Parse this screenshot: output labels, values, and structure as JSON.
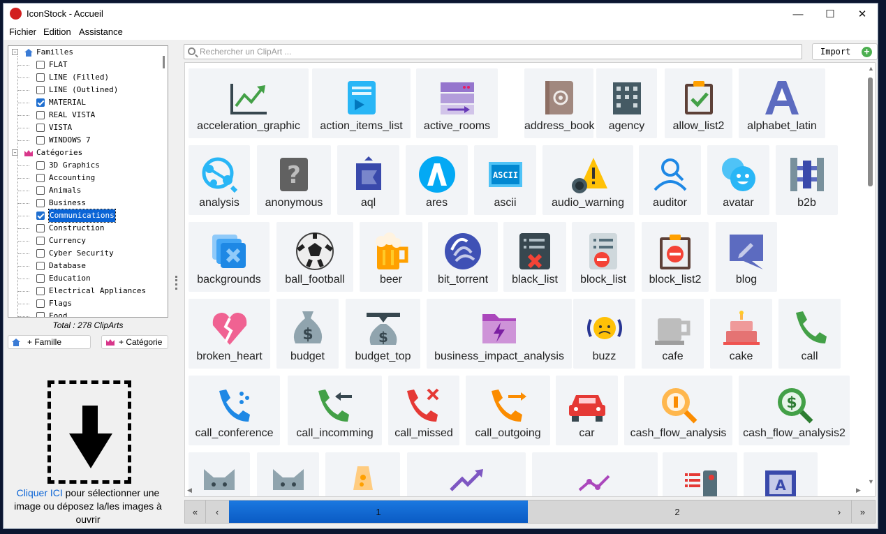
{
  "window": {
    "title": "IconStock - Accueil"
  },
  "menu": [
    "Fichier",
    "Edition",
    "Assistance"
  ],
  "tree": {
    "familles_label": "Familles",
    "familles": [
      {
        "label": "FLAT",
        "checked": false
      },
      {
        "label": "LINE (Filled)",
        "checked": false
      },
      {
        "label": "LINE (Outlined)",
        "checked": false
      },
      {
        "label": "MATERIAL",
        "checked": true
      },
      {
        "label": "REAL VISTA",
        "checked": false
      },
      {
        "label": "VISTA",
        "checked": false
      },
      {
        "label": "WINDOWS 7",
        "checked": false
      }
    ],
    "categories_label": "Catégories",
    "categories": [
      {
        "label": "3D Graphics",
        "checked": false
      },
      {
        "label": "Accounting",
        "checked": false
      },
      {
        "label": "Animals",
        "checked": false
      },
      {
        "label": "Business",
        "checked": false
      },
      {
        "label": "Communications",
        "checked": true,
        "selected": true
      },
      {
        "label": "Construction",
        "checked": false
      },
      {
        "label": "Currency",
        "checked": false
      },
      {
        "label": "Cyber Security",
        "checked": false
      },
      {
        "label": "Database",
        "checked": false
      },
      {
        "label": "Education",
        "checked": false
      },
      {
        "label": "Electrical Appliances",
        "checked": false
      },
      {
        "label": "Flags",
        "checked": false
      },
      {
        "label": "Food",
        "checked": false
      }
    ]
  },
  "total": "Total : 278 ClipArts",
  "buttons": {
    "add_family": "+ Famille",
    "add_category": "+ Catégorie",
    "import": "Import"
  },
  "dropzone": {
    "link": "Cliquer ICI",
    "text": " pour sélectionner une image ou déposez la/les images à ouvrir"
  },
  "search": {
    "placeholder": "Rechercher un ClipArt ..."
  },
  "pager": {
    "pages": [
      "1",
      "2"
    ],
    "current": "1"
  },
  "clips": [
    {
      "name": "acceleration_graphic",
      "icon": "chart-growth-icon"
    },
    {
      "name": "action_items_list",
      "icon": "list-icon"
    },
    {
      "name": "active_rooms",
      "icon": "server-rack-icon"
    },
    {
      "name": "address_book",
      "icon": "address-book-icon"
    },
    {
      "name": "agency",
      "icon": "building-icon"
    },
    {
      "name": "allow_list2",
      "icon": "clipboard-check-icon"
    },
    {
      "name": "alphabet_latin",
      "icon": "letter-a-icon"
    },
    {
      "name": "analysis",
      "icon": "share-nodes-icon"
    },
    {
      "name": "anonymous",
      "icon": "question-icon"
    },
    {
      "name": "aql",
      "icon": "flag-icon"
    },
    {
      "name": "ares",
      "icon": "triangle-circle-icon"
    },
    {
      "name": "ascii",
      "icon": "ascii-badge-icon"
    },
    {
      "name": "audio_warning",
      "icon": "warning-triangle-icon"
    },
    {
      "name": "auditor",
      "icon": "person-outline-icon"
    },
    {
      "name": "avatar",
      "icon": "smiley-avatar-icon"
    },
    {
      "name": "b2b",
      "icon": "b2b-icon"
    },
    {
      "name": "backgrounds",
      "icon": "stacked-layers-icon"
    },
    {
      "name": "ball_football",
      "icon": "soccer-ball-icon"
    },
    {
      "name": "beer",
      "icon": "beer-mug-icon"
    },
    {
      "name": "bit_torrent",
      "icon": "torrent-icon"
    },
    {
      "name": "black_list",
      "icon": "blacklist-icon"
    },
    {
      "name": "block_list",
      "icon": "block-list-icon"
    },
    {
      "name": "block_list2",
      "icon": "clipboard-block-icon"
    },
    {
      "name": "blog",
      "icon": "speech-pencil-icon"
    },
    {
      "name": "broken_heart",
      "icon": "broken-heart-icon"
    },
    {
      "name": "budget",
      "icon": "money-bag-icon"
    },
    {
      "name": "budget_top",
      "icon": "money-bag-scale-icon"
    },
    {
      "name": "business_impact_analysis",
      "icon": "folder-bolt-icon"
    },
    {
      "name": "buzz",
      "icon": "buzz-face-icon"
    },
    {
      "name": "cafe",
      "icon": "coffee-cup-icon"
    },
    {
      "name": "cake",
      "icon": "cake-icon"
    },
    {
      "name": "call",
      "icon": "phone-icon"
    },
    {
      "name": "call_conference",
      "icon": "phone-conference-icon"
    },
    {
      "name": "call_incomming",
      "icon": "phone-incoming-icon"
    },
    {
      "name": "call_missed",
      "icon": "phone-missed-icon"
    },
    {
      "name": "call_outgoing",
      "icon": "phone-outgoing-icon"
    },
    {
      "name": "car",
      "icon": "car-icon"
    },
    {
      "name": "cash_flow_analysis",
      "icon": "magnifier-coin-icon"
    },
    {
      "name": "cash_flow_analysis2",
      "icon": "magnifier-dollar-icon"
    },
    {
      "name": "",
      "icon": "cat-icon"
    },
    {
      "name": "",
      "icon": "cat-icon"
    },
    {
      "name": "",
      "icon": "lava-lamp-icon"
    },
    {
      "name": "",
      "icon": "trend-up-icon"
    },
    {
      "name": "",
      "icon": "trend-line-icon"
    },
    {
      "name": "",
      "icon": "list-card-icon"
    },
    {
      "name": "",
      "icon": "letter-a-card-icon"
    }
  ]
}
